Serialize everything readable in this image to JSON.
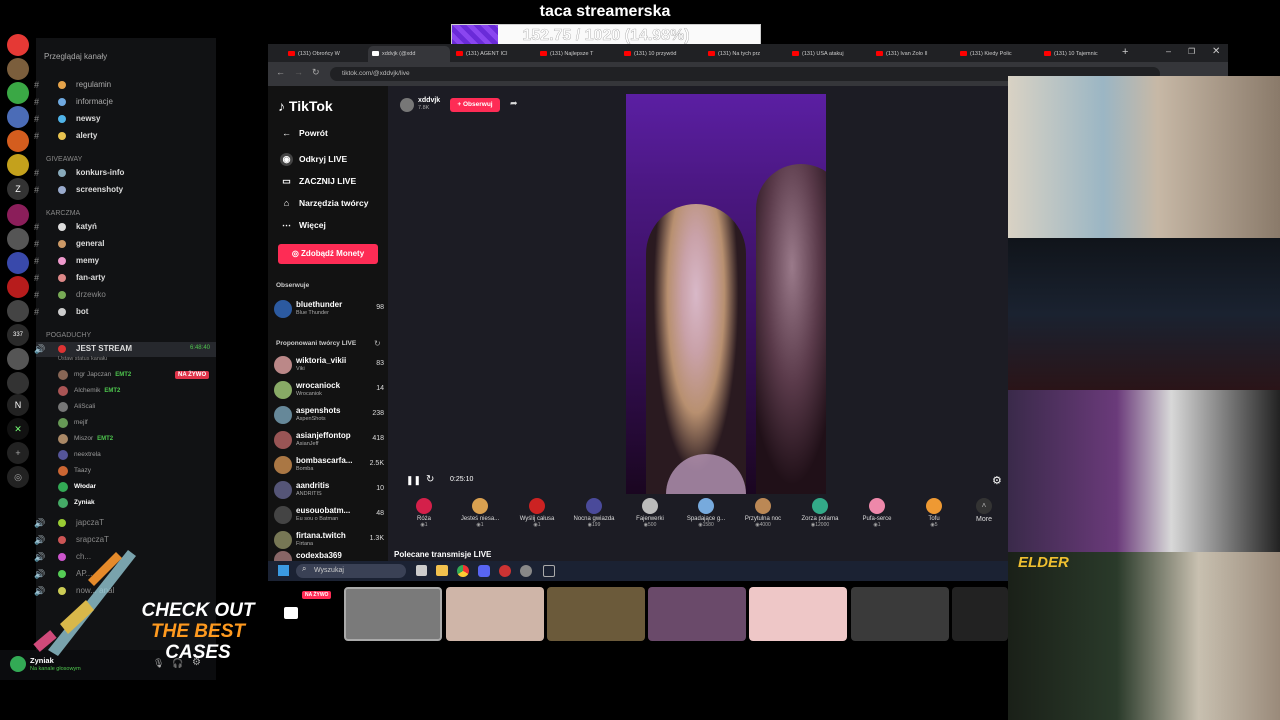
{
  "overlay": {
    "title": "taca streamerska",
    "progress_text": "152.75 / 1020 (14.98%)",
    "progress": 0.1498
  },
  "discord": {
    "header": "Przeglądaj kanały",
    "categories": {
      "giveaway": "GIVEAWAY",
      "karczma": "KARCZMA",
      "pogaduchy": "POGADUCHY"
    },
    "channels_top": [
      "regulamin",
      "informacje",
      "newsy",
      "alerty"
    ],
    "channels_giveaway": [
      "konkurs-info",
      "screenshoty"
    ],
    "channels_karczma": [
      "katyń",
      "general",
      "memy",
      "fan-arty",
      "drzewko",
      "bot"
    ],
    "voice_channel": {
      "name": "JEST STREAM",
      "time": "6:48:40",
      "status": "Ustaw status kanału",
      "live_badge": "NA ŻYWO"
    },
    "voice_users": [
      {
        "name": "mgr Japczan",
        "tag": "EMT2"
      },
      {
        "name": "Alchemik",
        "tag": "EMT2"
      },
      {
        "name": "AliScali",
        "tag": ""
      },
      {
        "name": "mejlf",
        "tag": ""
      },
      {
        "name": "Miszor",
        "tag": "EMT2"
      },
      {
        "name": "neextrela",
        "tag": ""
      },
      {
        "name": "Taazy",
        "tag": ""
      },
      {
        "name": "Włodar",
        "tag": ""
      },
      {
        "name": "Zyniak",
        "tag": ""
      }
    ],
    "other_voice": [
      "japczaT",
      "srapczaT",
      "ch...",
      "AP...",
      "now... anal"
    ],
    "user": {
      "name": "Zyniak",
      "status": "Na kanale głosowym"
    },
    "server_badge": "337"
  },
  "ad": {
    "line1": "CHECK OUT",
    "line2": "THE BEST",
    "line3": "CASES"
  },
  "browser": {
    "tabs": [
      "(131) Obrońcy W",
      "xddvjk (@xdd",
      "(131) AGENT ICI",
      "(131) Najlepsze T",
      "(131) 10 przywód",
      "(131) Na tych prz",
      "(131) USA atakuj",
      "(131) Ivan Zolo II",
      "(131) Kiedy Polic",
      "(131) 10 Tajemnic"
    ],
    "url": "tiktok.com/@xddvjk/live"
  },
  "tiktok": {
    "logo": "TikTok",
    "nav": {
      "back": "Powrót",
      "discover": "Odkryj LIVE",
      "go_live": "ZACZNIJ LIVE",
      "creator_tools": "Narzędzia twórcy",
      "more": "Więcej"
    },
    "coins_button": "Zdobądź Monety",
    "following_label": "Obserwuje",
    "following": [
      {
        "name": "bluethunder",
        "sub": "Blue Thunder",
        "count": "98"
      }
    ],
    "suggested_label": "Proponowani twórcy LIVE",
    "suggested": [
      {
        "name": "wiktoria_vikii",
        "sub": "Viki",
        "count": "83"
      },
      {
        "name": "wrocaniock",
        "sub": "Wrocaniok",
        "count": "14"
      },
      {
        "name": "aspenshots",
        "sub": "AspenShots",
        "count": "238"
      },
      {
        "name": "asianjeffontop",
        "sub": "AsianJeff",
        "count": "418"
      },
      {
        "name": "bombascarfa...",
        "sub": "Bomba",
        "count": "2.5K"
      },
      {
        "name": "aandritis",
        "sub": "ANDRITIS",
        "count": "10"
      },
      {
        "name": "eusouobatm...",
        "sub": "Eu sou o Batman",
        "count": "48"
      },
      {
        "name": "firtana.twitch",
        "sub": "Firtana",
        "count": "1.3K"
      },
      {
        "name": "codexba369",
        "sub": "",
        "count": ""
      }
    ],
    "streamer": {
      "name": "xddvjk",
      "viewers": "7.8K",
      "follow": "+ Obserwuj"
    },
    "time": "0:25:10",
    "gifts": [
      {
        "name": "Róża",
        "price": "1"
      },
      {
        "name": "Jesteś niesa...",
        "price": "1"
      },
      {
        "name": "Wyślij całusa",
        "price": "1"
      },
      {
        "name": "Nocna gwiazda",
        "price": "199"
      },
      {
        "name": "Fajerwerki",
        "price": "500"
      },
      {
        "name": "Spadające g...",
        "price": "1580"
      },
      {
        "name": "Przytulna noc",
        "price": "4000"
      },
      {
        "name": "Zorza polarna",
        "price": "12000"
      },
      {
        "name": "Pufa-serce",
        "price": "1"
      },
      {
        "name": "Tofu",
        "price": "5"
      }
    ],
    "more": "More",
    "recommended": "Polecane transmisje LIVE",
    "live_badge": "NA ŻYWO"
  },
  "taskbar": {
    "search": "Wyszukaj"
  },
  "cam_brand": "ELDER"
}
